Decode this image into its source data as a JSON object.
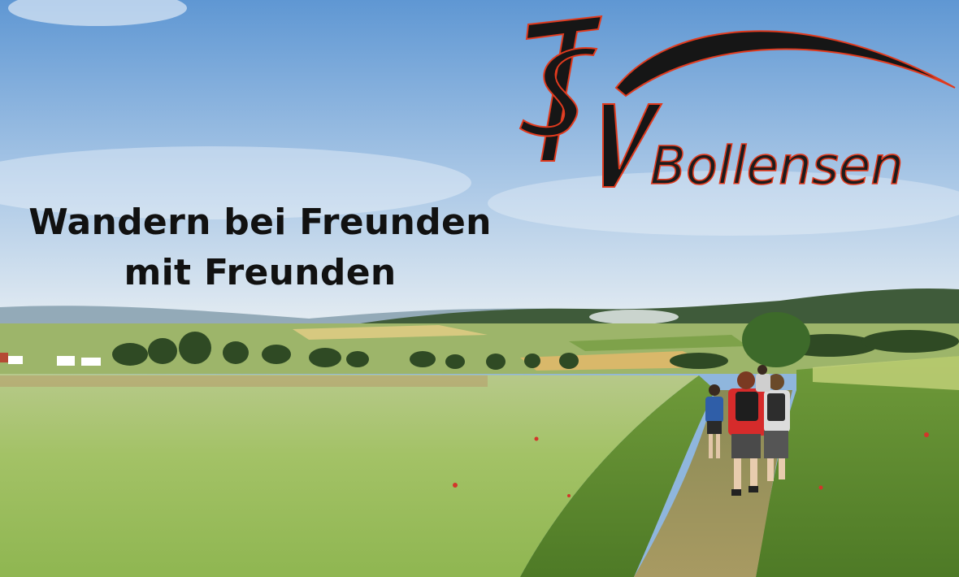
{
  "headline": {
    "line1": "Wandern bei Freunden",
    "line2": "mit Freunden"
  },
  "logo": {
    "initials": "TSV",
    "club_name": "Bollensen",
    "text_color": "#1a1a1a",
    "outline_color": "#e03a1e"
  },
  "scene": {
    "description_colors": {
      "sky_top": "#6fa2d8",
      "sky_bottom": "#dbe7f1",
      "field": "#a8c46a",
      "grass": "#5e8a2e",
      "jersey": "#d62b2b"
    }
  }
}
